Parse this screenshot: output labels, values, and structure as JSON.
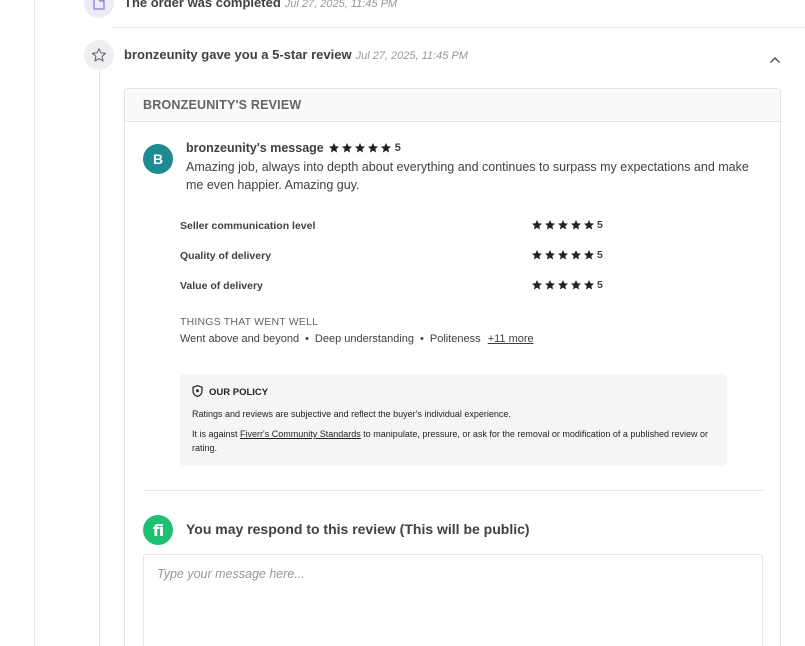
{
  "timeline": {
    "completed": {
      "text": "The order was completed",
      "date": "Jul 27, 2025, 11:45 PM",
      "icon": "document-icon"
    },
    "review_event": {
      "text": "bronzeunity gave you a 5-star review",
      "date": "Jul 27, 2025, 11:45 PM",
      "icon": "star-outline-icon"
    }
  },
  "review": {
    "header": "BRONZEUNITY'S REVIEW",
    "avatar_letter": "B",
    "message_title": "bronzeunity's message",
    "overall_rating": "5",
    "message": "Amazing job, always into depth about everything and continues to surpass my expectations and make me even happier. Amazing guy.",
    "ratings": [
      {
        "label": "Seller communication level",
        "value": "5"
      },
      {
        "label": "Quality of delivery",
        "value": "5"
      },
      {
        "label": "Value of delivery",
        "value": "5"
      }
    ],
    "things_title": "THINGS THAT WENT WELL",
    "things": [
      "Went above and beyond",
      "Deep understanding",
      "Politeness"
    ],
    "things_more": "+11 more"
  },
  "policy": {
    "title": "OUR POLICY",
    "line1": "Ratings and reviews are subjective and reflect the buyer's individual experience.",
    "line2_prefix": "It is against ",
    "line2_link": "Fiverr's Community Standards",
    "line2_suffix": " to manipulate, pressure, or ask for the removal or modification of a published review or rating."
  },
  "respond": {
    "logo_text": "fi",
    "title": "You may respond to this review (This will be public)",
    "placeholder": "Type your message here..."
  },
  "colors": {
    "avatar": "#1d8b8f",
    "fiverr_green": "#1dbf73",
    "star": "#222325"
  }
}
